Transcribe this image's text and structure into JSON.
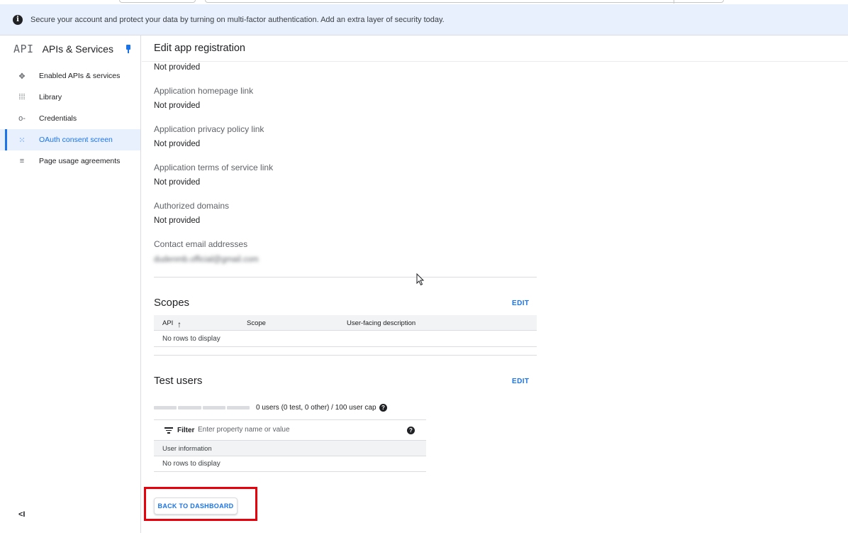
{
  "banner": {
    "text": "Secure your account and protect your data by turning on multi-factor authentication. Add an extra layer of security today."
  },
  "sidebar": {
    "logo": "API",
    "title": "APIs & Services",
    "items": [
      {
        "label": "Enabled APIs & services",
        "icon": "move-icon"
      },
      {
        "label": "Library",
        "icon": "library-icon"
      },
      {
        "label": "Credentials",
        "icon": "key-icon"
      },
      {
        "label": "OAuth consent screen",
        "icon": "consent-icon",
        "active": true
      },
      {
        "label": "Page usage agreements",
        "icon": "settings-list-icon"
      }
    ],
    "collapse_label": "<I"
  },
  "main": {
    "title": "Edit app registration",
    "fields": [
      {
        "label": "",
        "value": "Not provided"
      },
      {
        "label": "Application homepage link",
        "value": "Not provided"
      },
      {
        "label": "Application privacy policy link",
        "value": "Not provided"
      },
      {
        "label": "Application terms of service link",
        "value": "Not provided"
      },
      {
        "label": "Authorized domains",
        "value": "Not provided"
      },
      {
        "label": "Contact email addresses",
        "value": "dudenmb.official@gmail.com"
      }
    ],
    "scopes": {
      "title": "Scopes",
      "edit": "EDIT",
      "columns": [
        "API",
        "Scope",
        "User-facing description"
      ],
      "empty": "No rows to display"
    },
    "test_users": {
      "title": "Test users",
      "edit": "EDIT",
      "cap_text": "0 users (0 test, 0 other) / 100 user cap",
      "filter_label": "Filter",
      "filter_placeholder": "Enter property name or value",
      "column": "User information",
      "empty": "No rows to display"
    },
    "back_button": "BACK TO DASHBOARD"
  },
  "colors": {
    "accent": "#1a73e8",
    "banner_bg": "#e8f0fe",
    "highlight": "#e8000b"
  }
}
